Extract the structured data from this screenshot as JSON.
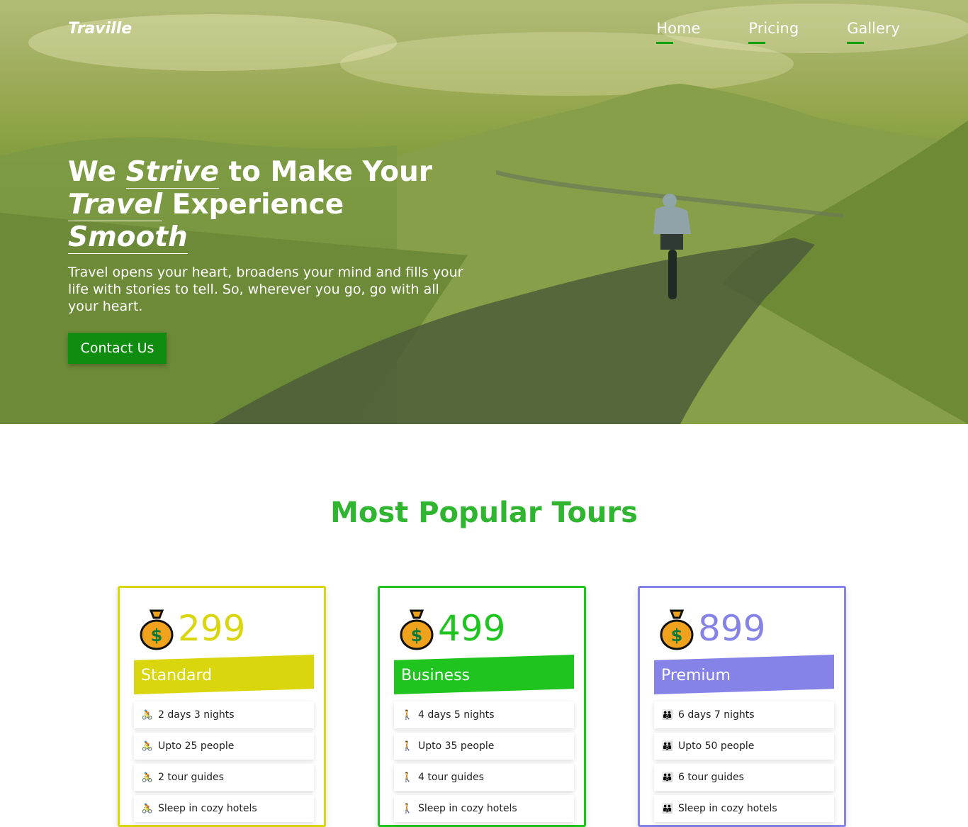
{
  "header": {
    "logo": "Traville",
    "nav": [
      {
        "label": "Home"
      },
      {
        "label": "Pricing"
      },
      {
        "label": "Gallery"
      }
    ]
  },
  "hero": {
    "headline": {
      "w1": "We",
      "w2": "Strive",
      "w3": "to Make Your",
      "w4": "Travel",
      "w5": "Experience",
      "w6": "Smooth"
    },
    "subtext": "Travel opens your heart, broadens your mind and fills your life with stories to tell. So, wherever you go, go with all your heart.",
    "cta": "Contact Us"
  },
  "section": {
    "title": "Most Popular Tours"
  },
  "plans": [
    {
      "price": "299",
      "name": "Standard",
      "color": "#dad60e",
      "icon": "bicycle-icon",
      "features": [
        "2 days 3 nights",
        "Upto 25 people",
        "2 tour guides",
        "Sleep in cozy hotels"
      ]
    },
    {
      "price": "499",
      "name": "Business",
      "color": "#1fc41f",
      "icon": "hiker-icon",
      "features": [
        "4 days 5 nights",
        "Upto 35 people",
        "4 tour guides",
        "Sleep in cozy hotels"
      ]
    },
    {
      "price": "899",
      "name": "Premium",
      "color": "#8683e8",
      "icon": "family-icon",
      "features": [
        "6 days 7 nights",
        "Upto 50 people",
        "6 tour guides",
        "Sleep in cozy hotels"
      ]
    }
  ]
}
